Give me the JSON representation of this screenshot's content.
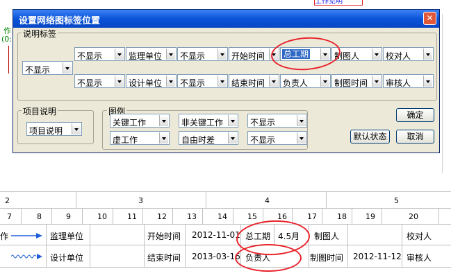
{
  "background": {
    "top_frag_1": "作",
    "top_frag_2": "(0:",
    "top_right_tag": "工作见明"
  },
  "dialog": {
    "title": "设置网络图标签位置",
    "close_glyph": "✕",
    "groups": {
      "label_group": "说明标签",
      "item_group": "项目说明",
      "legend_group": "图例"
    },
    "left_combo": "不显示",
    "row1": [
      "不显示",
      "监理单位",
      "不显示",
      "开始时间",
      "总工期",
      "制图人",
      "校对人"
    ],
    "row2": [
      "不显示",
      "设计单位",
      "不显示",
      "结束时间",
      "负责人",
      "制图时间",
      "审核人"
    ],
    "item_combo": "项目说明",
    "legend_row1": [
      "关键工作",
      "非关键工作",
      "不显示"
    ],
    "legend_row2": [
      "虚工作",
      "自由时差",
      "不显示"
    ],
    "buttons": {
      "ok": "确定",
      "default": "默认状态",
      "cancel": "取消"
    }
  },
  "timeline": {
    "top_numbers": [
      "2",
      "3",
      "4",
      "5"
    ],
    "bottom_numbers": [
      "7",
      "8",
      "9",
      "10",
      "11",
      "12",
      "13",
      "14",
      "15",
      "16",
      "17",
      "18",
      "19",
      "20"
    ]
  },
  "legend_table": {
    "row1": {
      "frag": "作",
      "unit_label": "监理单位",
      "start_label": "开始时间",
      "start_value": "2012-11-01",
      "total_label": "总工期",
      "total_value": "4.5月",
      "drawer_label": "制图人",
      "checker_label": "校对人"
    },
    "row2": {
      "unit_label": "设计单位",
      "end_label": "结束时间",
      "end_value": "2013-03-16",
      "owner_label": "负责人",
      "draw_time_label": "制图时间",
      "draw_time_value": "2012-11-12",
      "reviewer_label": "审核人"
    }
  },
  "colors": {
    "title_bar": "#0a54d9",
    "dialog_bg": "#ece9d8",
    "highlight": "#e8232b",
    "arrow_blue": "#1e5fd6"
  }
}
